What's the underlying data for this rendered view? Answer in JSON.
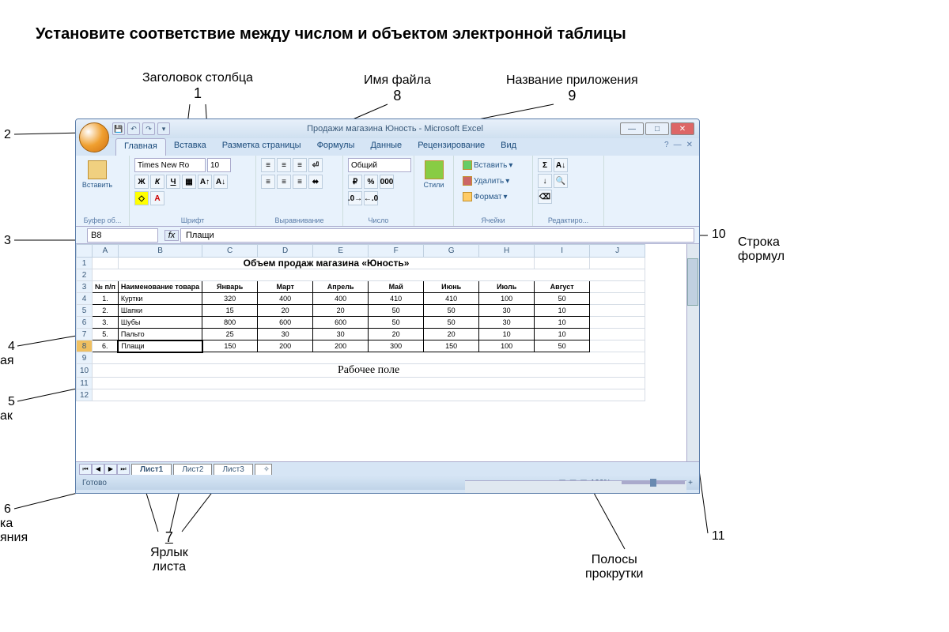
{
  "task_title": "Установите соответствие между числом и объектом электронной таблицы",
  "annotations": {
    "col_header": {
      "label": "Заголовок столбца",
      "num": "1"
    },
    "left2": {
      "num": "2"
    },
    "left3": {
      "num": "3"
    },
    "left4": {
      "num": "4",
      "suffix": "ая"
    },
    "left5": {
      "num": "5",
      "suffix": "ак"
    },
    "left6": {
      "num": "6",
      "suffix1": "ка",
      "suffix2": "яния"
    },
    "sheet_tab": {
      "label": "Ярлык листа",
      "num": "7"
    },
    "filename": {
      "label": "Имя файла",
      "num": "8"
    },
    "appname": {
      "label": "Название приложения",
      "num": "9"
    },
    "formula_bar": {
      "label": "Строка формул",
      "num": "10"
    },
    "scrollbars": {
      "label": "Полосы прокрутки",
      "num": "11"
    }
  },
  "window": {
    "file_title": "Продажи магазина Юность",
    "app_title": "Microsoft Excel",
    "tabs": [
      "Главная",
      "Вставка",
      "Разметка страницы",
      "Формулы",
      "Данные",
      "Рецензирование",
      "Вид"
    ],
    "ribbon_groups": {
      "clipboard": {
        "label": "Буфер об...",
        "paste": "Вставить"
      },
      "font": {
        "label": "Шрифт",
        "name": "Times New Ro",
        "size": "10",
        "bold": "Ж",
        "italic": "К",
        "underline": "Ч"
      },
      "alignment": {
        "label": "Выравнивание"
      },
      "number": {
        "label": "Число",
        "format": "Общий"
      },
      "styles": {
        "label": "Стили"
      },
      "cells": {
        "label": "Ячейки",
        "insert": "Вставить",
        "delete": "Удалить",
        "format": "Формат"
      },
      "editing": {
        "label": "Редактиро..."
      }
    },
    "namebox": "B8",
    "formula": "Плащи"
  },
  "grid": {
    "cols": [
      "A",
      "B",
      "C",
      "D",
      "E",
      "F",
      "G",
      "H",
      "I",
      "J"
    ],
    "rows": [
      "1",
      "2",
      "3",
      "4",
      "5",
      "6",
      "7",
      "8",
      "9",
      "10",
      "11",
      "12"
    ],
    "title": "Объем продаж магазина «Юность»",
    "field_label": "Рабочее поле",
    "headers": [
      "№ п/п",
      "Наименование товара",
      "Январь",
      "Март",
      "Апрель",
      "Май",
      "Июнь",
      "Июль",
      "Август"
    ],
    "data": [
      [
        "1.",
        "Куртки",
        "320",
        "400",
        "400",
        "410",
        "410",
        "100",
        "50"
      ],
      [
        "2.",
        "Шапки",
        "15",
        "20",
        "20",
        "50",
        "50",
        "30",
        "10"
      ],
      [
        "3.",
        "Шубы",
        "800",
        "600",
        "600",
        "50",
        "50",
        "30",
        "10"
      ],
      [
        "5.",
        "Пальто",
        "25",
        "30",
        "30",
        "20",
        "20",
        "10",
        "10"
      ],
      [
        "6.",
        "Плащи",
        "150",
        "200",
        "200",
        "300",
        "150",
        "100",
        "50"
      ]
    ]
  },
  "sheets": {
    "tabs": [
      "Лист1",
      "Лист2",
      "Лист3"
    ]
  },
  "statusbar": {
    "ready": "Готово",
    "zoom": "100%"
  }
}
